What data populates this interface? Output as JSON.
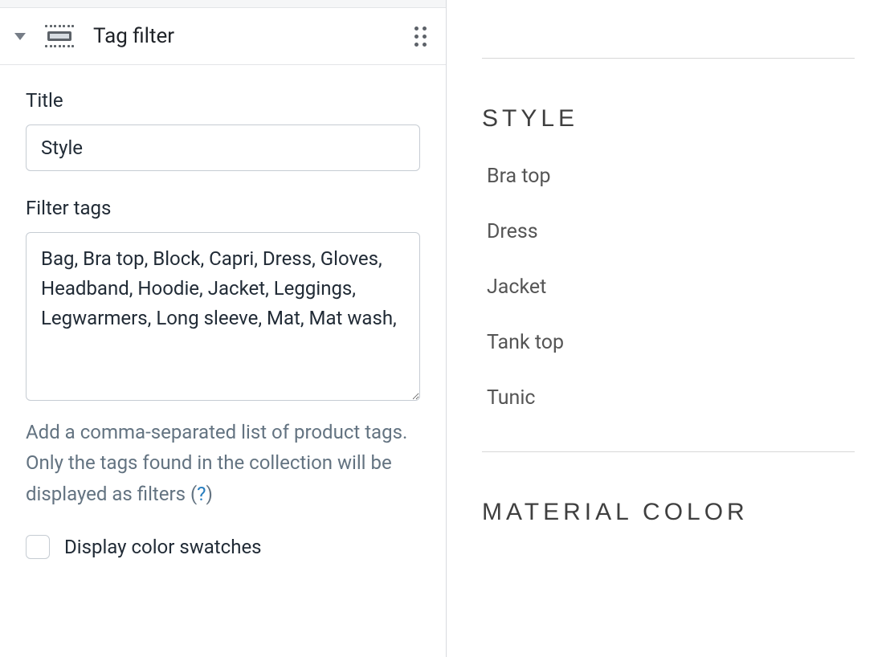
{
  "editor": {
    "block_name": "Tag filter",
    "fields": {
      "title": {
        "label": "Title",
        "value": "Style"
      },
      "filter_tags": {
        "label": "Filter tags",
        "value": "Bag, Bra top, Block, Capri, Dress, Gloves, Headband, Hoodie, Jacket, Leggings, Legwarmers, Long sleeve, Mat, Mat wash,",
        "help_prefix": "Add a comma-separated list of product tags. Only the tags found in the collection will be displayed as filters (",
        "help_link": "?",
        "help_suffix": ")"
      },
      "color_swatches": {
        "label": "Display color swatches",
        "checked": false
      }
    }
  },
  "preview": {
    "sections": [
      {
        "heading": "STYLE",
        "items": [
          "Bra top",
          "Dress",
          "Jacket",
          "Tank top",
          "Tunic"
        ]
      },
      {
        "heading": "MATERIAL COLOR",
        "items": []
      }
    ]
  }
}
